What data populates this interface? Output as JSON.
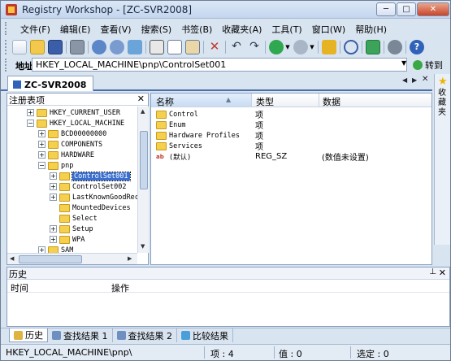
{
  "window": {
    "title": "Registry Workshop - [ZC-SVR2008]"
  },
  "titlebar_buttons": {
    "minimize": "─",
    "maximize": "□",
    "close": "✕"
  },
  "menu": [
    "文件(F)",
    "编辑(E)",
    "查看(V)",
    "搜索(S)",
    "书签(B)",
    "收藏夹(A)",
    "工具(T)",
    "窗口(W)",
    "帮助(H)"
  ],
  "toolbar": {
    "icons": [
      "open-icon",
      "folder-open-icon",
      "save-icon",
      "print-icon",
      "connect-icon",
      "disconnect-icon",
      "refresh-icon",
      "cut-icon",
      "copy-icon",
      "paste-icon",
      "delete-icon",
      "undo-icon",
      "redo-icon",
      "back-icon",
      "forward-icon",
      "up-icon",
      "find-icon",
      "export-icon",
      "settings-icon",
      "help-icon"
    ]
  },
  "address": {
    "label": "地址",
    "value": "HKEY_LOCAL_MACHINE\\pnp\\ControlSet001",
    "goto_label": "转到"
  },
  "doc_tab": {
    "label": "ZC-SVR2008"
  },
  "favorites_side": {
    "label": "收藏夹"
  },
  "left_pane": {
    "title": "注册表项",
    "tree": [
      {
        "label": "HKEY_CURRENT_USER",
        "expander": "+"
      },
      {
        "label": "HKEY_LOCAL_MACHINE",
        "expander": "−"
      },
      {
        "label": "BCD00000000",
        "expander": "+"
      },
      {
        "label": "COMPONENTS",
        "expander": "+"
      },
      {
        "label": "HARDWARE",
        "expander": "+"
      },
      {
        "label": "pnp",
        "expander": "−"
      },
      {
        "label": "ControlSet001",
        "expander": "+",
        "selected": true
      },
      {
        "label": "ControlSet002",
        "expander": "+"
      },
      {
        "label": "LastKnownGoodRec",
        "expander": "+"
      },
      {
        "label": "MountedDevices",
        "expander": ""
      },
      {
        "label": "Select",
        "expander": ""
      },
      {
        "label": "Setup",
        "expander": "+"
      },
      {
        "label": "WPA",
        "expander": "+"
      },
      {
        "label": "SAM",
        "expander": "+"
      }
    ]
  },
  "right_pane": {
    "columns": {
      "name": "名称",
      "type": "类型",
      "data": "数据"
    },
    "rows": [
      {
        "name": "Control",
        "type": "项",
        "data": "",
        "icon": "folder-icon"
      },
      {
        "name": "Enum",
        "type": "项",
        "data": "",
        "icon": "folder-icon"
      },
      {
        "name": "Hardware Profiles",
        "type": "项",
        "data": "",
        "icon": "folder-icon"
      },
      {
        "name": "Services",
        "type": "项",
        "data": "",
        "icon": "folder-icon"
      },
      {
        "name": "(默认)",
        "type": "REG_SZ",
        "data": "(数值未设置)",
        "icon": "string-value-icon"
      }
    ]
  },
  "history": {
    "title": "历史",
    "col_time": "时间",
    "col_action": "操作"
  },
  "bottom_tabs": [
    "历史",
    "查找结果 1",
    "查找结果 2",
    "比较结果"
  ],
  "status": {
    "path": "HKEY_LOCAL_MACHINE\\pnp\\",
    "items": "项 : 4",
    "values": "值 : 0",
    "selected": "选定 : 0"
  },
  "colors": {
    "selection": "#3a6fd0",
    "folder": "#f5cf4e",
    "frame": "#d9e4f1"
  }
}
